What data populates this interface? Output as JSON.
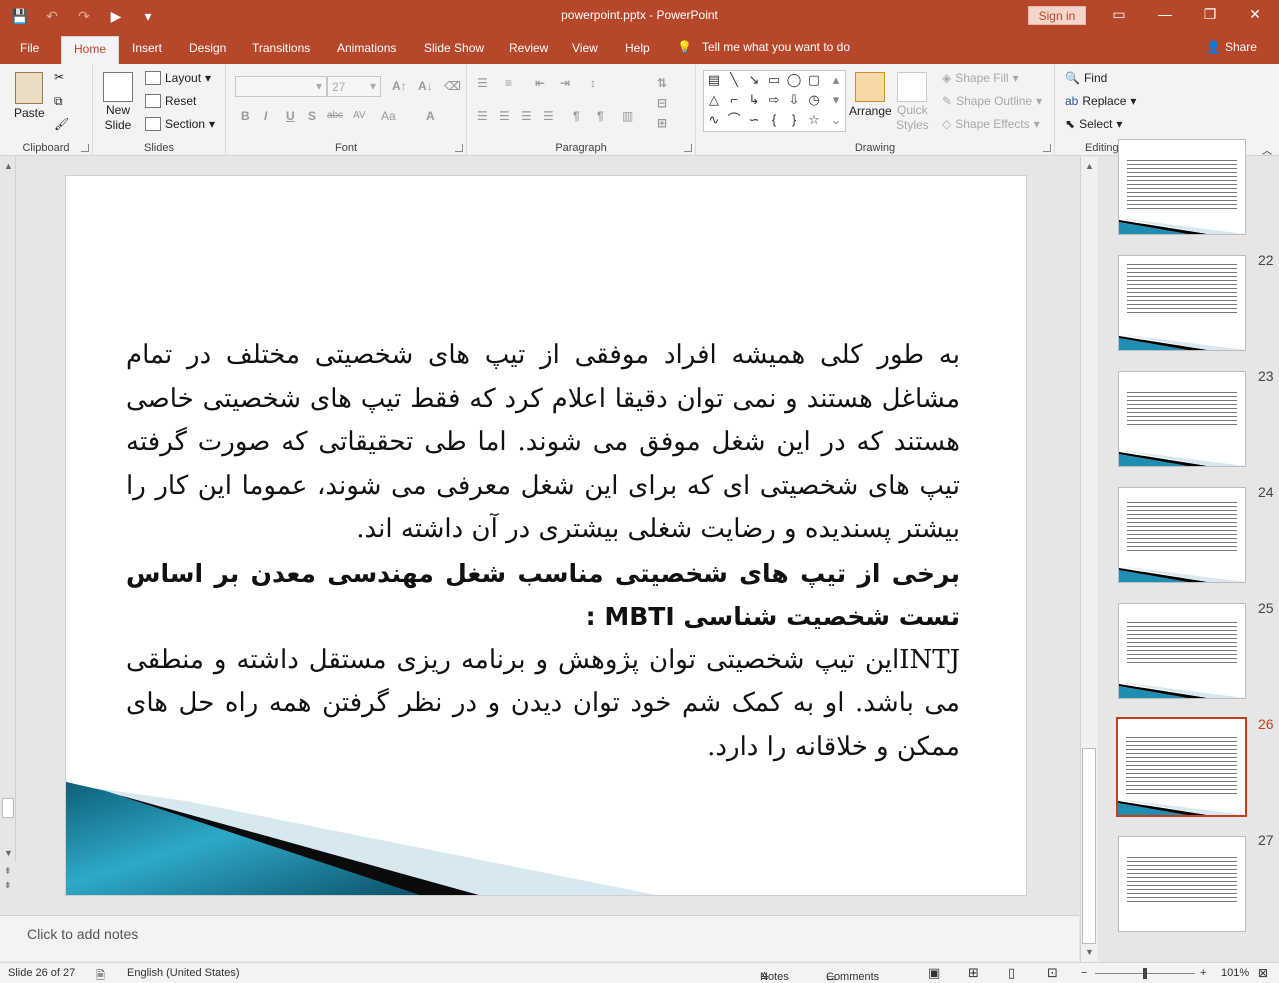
{
  "window": {
    "title": "powerpoint.pptx  -  PowerPoint",
    "signin": "Sign in",
    "controls": {
      "restore_ribbon": "▭",
      "minimize": "—",
      "maximize": "❐",
      "close": "✕"
    }
  },
  "qat": {
    "save": "💾",
    "undo": "↶",
    "redo": "↷",
    "present": "▶",
    "customize": "▾"
  },
  "tabs": [
    "File",
    "Home",
    "Insert",
    "Design",
    "Transitions",
    "Animations",
    "Slide Show",
    "Review",
    "View",
    "Help"
  ],
  "active_tab": "Home",
  "tellme": {
    "icon": "lightbulb-icon",
    "text": "Tell me what you want to do"
  },
  "share": "Share",
  "ribbon": {
    "clipboard": {
      "label": "Clipboard",
      "paste": "Paste"
    },
    "slides": {
      "label": "Slides",
      "new_slide_1": "New",
      "new_slide_2": "Slide",
      "layout": "Layout",
      "reset": "Reset",
      "section": "Section"
    },
    "font": {
      "label": "Font",
      "font_name": "",
      "font_size": "27",
      "bold": "B",
      "italic": "I",
      "underline": "U",
      "shadow": "S",
      "strike": "abc",
      "spacing": "AV",
      "case": "Aa",
      "color": "A"
    },
    "paragraph": {
      "label": "Paragraph"
    },
    "drawing": {
      "label": "Drawing",
      "arrange": "Arrange",
      "quick_styles_1": "Quick",
      "quick_styles_2": "Styles",
      "shape_fill": "Shape Fill",
      "shape_outline": "Shape Outline",
      "shape_effects": "Shape Effects"
    },
    "editing": {
      "label": "Editing",
      "find": "Find",
      "replace": "Replace",
      "select": "Select"
    }
  },
  "slide": {
    "paragraph1": "به طور کلی همیشه افراد موفقی از تیپ های شخصیتی مختلف در تمام مشاغل هستند و نمی توان دقیقا اعلام کرد که فقط تیپ های شخصیتی خاصی هستند که در این شغل موفق می شوند. اما طی تحقیقاتی که صورت گرفته تیپ های شخصیتی ای که برای این شغل معرفی می شوند، عموما این کار را بیشتر پسندیده و رضایت شغلی بیشتری در آن داشته اند.",
    "heading": "برخی از تیپ های شخصیتی مناسب شغل مهندسی معدن بر اساس تست شخصیت شناسی MBTI :",
    "paragraph2": "INTJاین تیپ شخصیتی توان پژوهش و برنامه ریزی مستقل داشته و منطقی می باشد. او به کمک شم خود توان دیدن و در نظر گرفتن همه راه حل های ممکن و خلاقانه را دارد."
  },
  "notes_placeholder": "Click to add notes",
  "thumbnails": [
    {
      "num": "",
      "selected": false
    },
    {
      "num": "22",
      "selected": false
    },
    {
      "num": "23",
      "selected": false
    },
    {
      "num": "24",
      "selected": false
    },
    {
      "num": "25",
      "selected": false
    },
    {
      "num": "26",
      "selected": true
    },
    {
      "num": "27",
      "selected": false
    }
  ],
  "status": {
    "slide_info": "Slide 26 of 27",
    "language": "English (United States)",
    "notes": "Notes",
    "comments": "Comments",
    "zoom_minus": "−",
    "zoom_plus": "+",
    "zoom": "101%",
    "zoom_level": 0.5
  },
  "colors": {
    "accent": "#b7472a",
    "selection": "#c43e1c"
  }
}
